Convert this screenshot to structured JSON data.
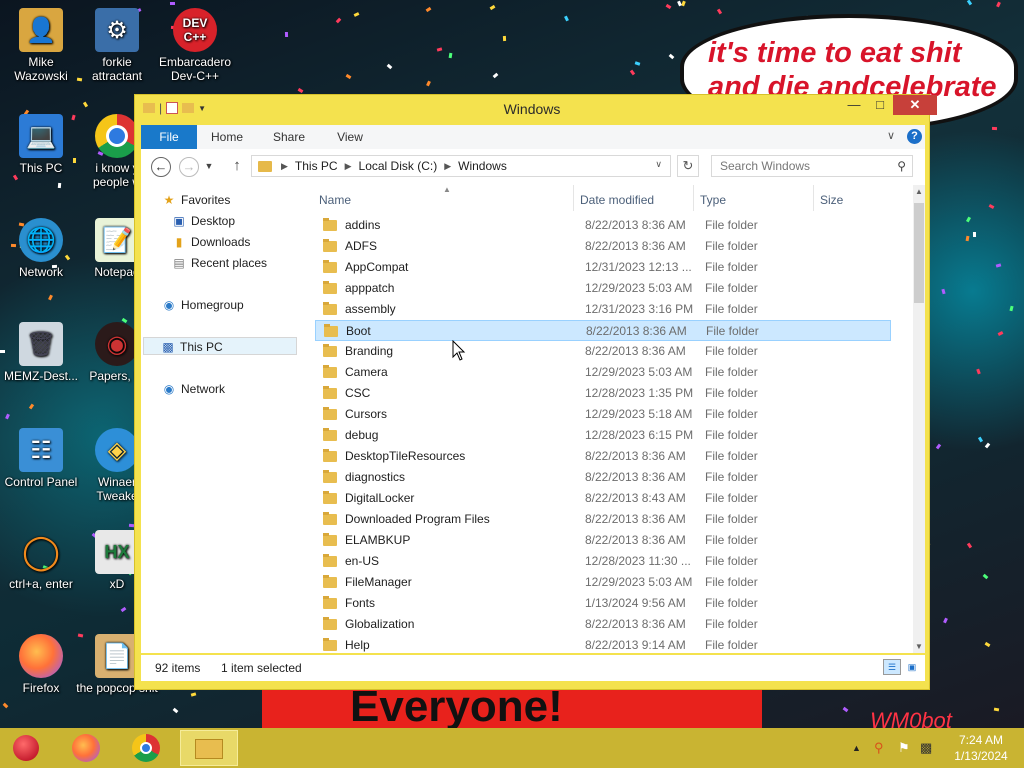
{
  "wallpaper": {
    "bubble_text": "it's time to eat shit and die andcelebrate",
    "banner_text": "Everyone!",
    "watermark": "WM0bot"
  },
  "desktop_icons": [
    {
      "label": "Mike Wazowski",
      "icon": "folder-person-icon"
    },
    {
      "label": "forkie attractant",
      "icon": "settings-monitor-icon"
    },
    {
      "label": "Embarcadero Dev-C++",
      "icon": "devcpp-icon"
    },
    {
      "label": "This PC",
      "icon": "computer-icon"
    },
    {
      "label": "i know y people w",
      "icon": "chrome-icon"
    },
    {
      "label": "Network",
      "icon": "network-globe-icon"
    },
    {
      "label": "Notepad",
      "icon": "notepad-icon"
    },
    {
      "label": "MEMZ-Dest...",
      "icon": "recycle-bin-icon"
    },
    {
      "label": "Papers, Pl",
      "icon": "papers-please-icon"
    },
    {
      "label": "Control Panel",
      "icon": "control-panel-icon"
    },
    {
      "label": "Winaer Tweake",
      "icon": "winaero-icon"
    },
    {
      "label": "ctrl+a, enter",
      "icon": "orange-ring-icon"
    },
    {
      "label": "xD",
      "icon": "hx-icon"
    },
    {
      "label": "Firefox",
      "icon": "firefox-icon"
    },
    {
      "label": "the popcop shit",
      "icon": "document-icon"
    }
  ],
  "window": {
    "title": "Windows",
    "colors": {
      "frame": "#f4e24e",
      "file_tab": "#1979ca",
      "close": "#c7403a",
      "selection": "#cce8ff"
    },
    "ribbon_tabs": [
      "File",
      "Home",
      "Share",
      "View"
    ],
    "address": {
      "crumbs": [
        "This PC",
        "Local Disk (C:)",
        "Windows"
      ]
    },
    "search_placeholder": "Search Windows",
    "nav": {
      "favorites": "Favorites",
      "desktop": "Desktop",
      "downloads": "Downloads",
      "recent_places": "Recent places",
      "homegroup": "Homegroup",
      "this_pc": "This PC",
      "network": "Network"
    },
    "columns": {
      "name": "Name",
      "date_modified": "Date modified",
      "type": "Type",
      "size": "Size"
    },
    "files": [
      {
        "name": "addins",
        "date": "8/22/2013 8:36 AM",
        "type": "File folder"
      },
      {
        "name": "ADFS",
        "date": "8/22/2013 8:36 AM",
        "type": "File folder"
      },
      {
        "name": "AppCompat",
        "date": "12/31/2023 12:13 ...",
        "type": "File folder"
      },
      {
        "name": "apppatch",
        "date": "12/29/2023 5:03 AM",
        "type": "File folder"
      },
      {
        "name": "assembly",
        "date": "12/31/2023 3:16 PM",
        "type": "File folder"
      },
      {
        "name": "Boot",
        "date": "8/22/2013 8:36 AM",
        "type": "File folder",
        "selected": true
      },
      {
        "name": "Branding",
        "date": "8/22/2013 8:36 AM",
        "type": "File folder"
      },
      {
        "name": "Camera",
        "date": "12/29/2023 5:03 AM",
        "type": "File folder"
      },
      {
        "name": "CSC",
        "date": "12/28/2023 1:35 PM",
        "type": "File folder"
      },
      {
        "name": "Cursors",
        "date": "12/29/2023 5:18 AM",
        "type": "File folder"
      },
      {
        "name": "debug",
        "date": "12/28/2023 6:15 PM",
        "type": "File folder"
      },
      {
        "name": "DesktopTileResources",
        "date": "8/22/2013 8:36 AM",
        "type": "File folder"
      },
      {
        "name": "diagnostics",
        "date": "8/22/2013 8:36 AM",
        "type": "File folder"
      },
      {
        "name": "DigitalLocker",
        "date": "8/22/2013 8:43 AM",
        "type": "File folder"
      },
      {
        "name": "Downloaded Program Files",
        "date": "8/22/2013 8:36 AM",
        "type": "File folder"
      },
      {
        "name": "ELAMBKUP",
        "date": "8/22/2013 8:36 AM",
        "type": "File folder"
      },
      {
        "name": "en-US",
        "date": "12/28/2023 11:30 ...",
        "type": "File folder"
      },
      {
        "name": "FileManager",
        "date": "12/29/2023 5:03 AM",
        "type": "File folder"
      },
      {
        "name": "Fonts",
        "date": "1/13/2024 9:56 AM",
        "type": "File folder"
      },
      {
        "name": "Globalization",
        "date": "8/22/2013 8:36 AM",
        "type": "File folder"
      },
      {
        "name": "Help",
        "date": "8/22/2013 9:14 AM",
        "type": "File folder"
      }
    ],
    "status": {
      "item_count": "92 items",
      "selected": "1 item selected"
    }
  },
  "taskbar": {
    "items": [
      "start-orb-icon",
      "firefox-icon",
      "chrome-icon",
      "file-explorer-icon"
    ],
    "tray_icons": [
      "show-hidden-icons",
      "search-icon",
      "flag-icon",
      "network-icon"
    ],
    "time": "7:24 AM",
    "date": "1/13/2024",
    "color": "#c9b432"
  }
}
